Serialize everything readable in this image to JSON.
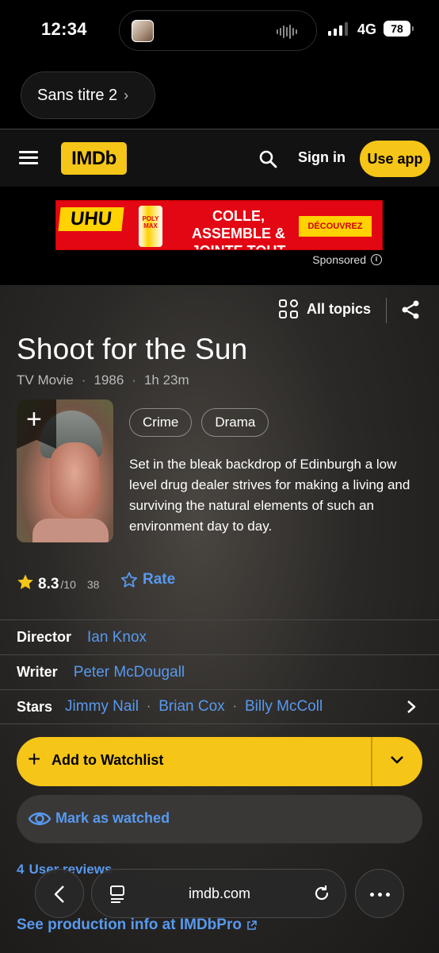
{
  "status_bar": {
    "time": "12:34",
    "network": "4G",
    "battery": "78"
  },
  "browser_tab": {
    "label": "Sans titre 2"
  },
  "header": {
    "logo": "IMDb",
    "sign_in": "Sign in",
    "use_app": "Use app"
  },
  "ad": {
    "brand": "UHU",
    "product": "POLY MAX",
    "headline": "COLLE, ASSEMBLE & JOINTE TOUT",
    "cta": "DÉCOUVREZ",
    "sponsored_label": "Sponsored"
  },
  "title_section": {
    "all_topics": "All topics",
    "title": "Shoot for the Sun",
    "meta": [
      "TV Movie",
      "1986",
      "1h 23m"
    ],
    "genres": [
      "Crime",
      "Drama"
    ],
    "plot": "Set in the bleak backdrop of Edinburgh a low level drug dealer strives for making a living and surviving the natural elements of such an environment day to day.",
    "rating": {
      "score": "8.3",
      "out_of": "/10",
      "votes": "38"
    },
    "rate_label": "Rate"
  },
  "credits": {
    "director": {
      "role": "Director",
      "names": [
        "Ian Knox"
      ]
    },
    "writer": {
      "role": "Writer",
      "names": [
        "Peter McDougall"
      ]
    },
    "stars": {
      "role": "Stars",
      "names": [
        "Jimmy Nail",
        "Brian Cox",
        "Billy McColl"
      ]
    }
  },
  "actions": {
    "watchlist": "Add to Watchlist",
    "mark_watched": "Mark as watched",
    "reviews_count": "4",
    "reviews_label": "User reviews",
    "imdbpro": "See production info at IMDbPro"
  },
  "safari": {
    "host": "imdb.com"
  },
  "colors": {
    "imdb_yellow": "#f5c518",
    "link_blue": "#5799ef",
    "ad_red": "#e30613"
  }
}
